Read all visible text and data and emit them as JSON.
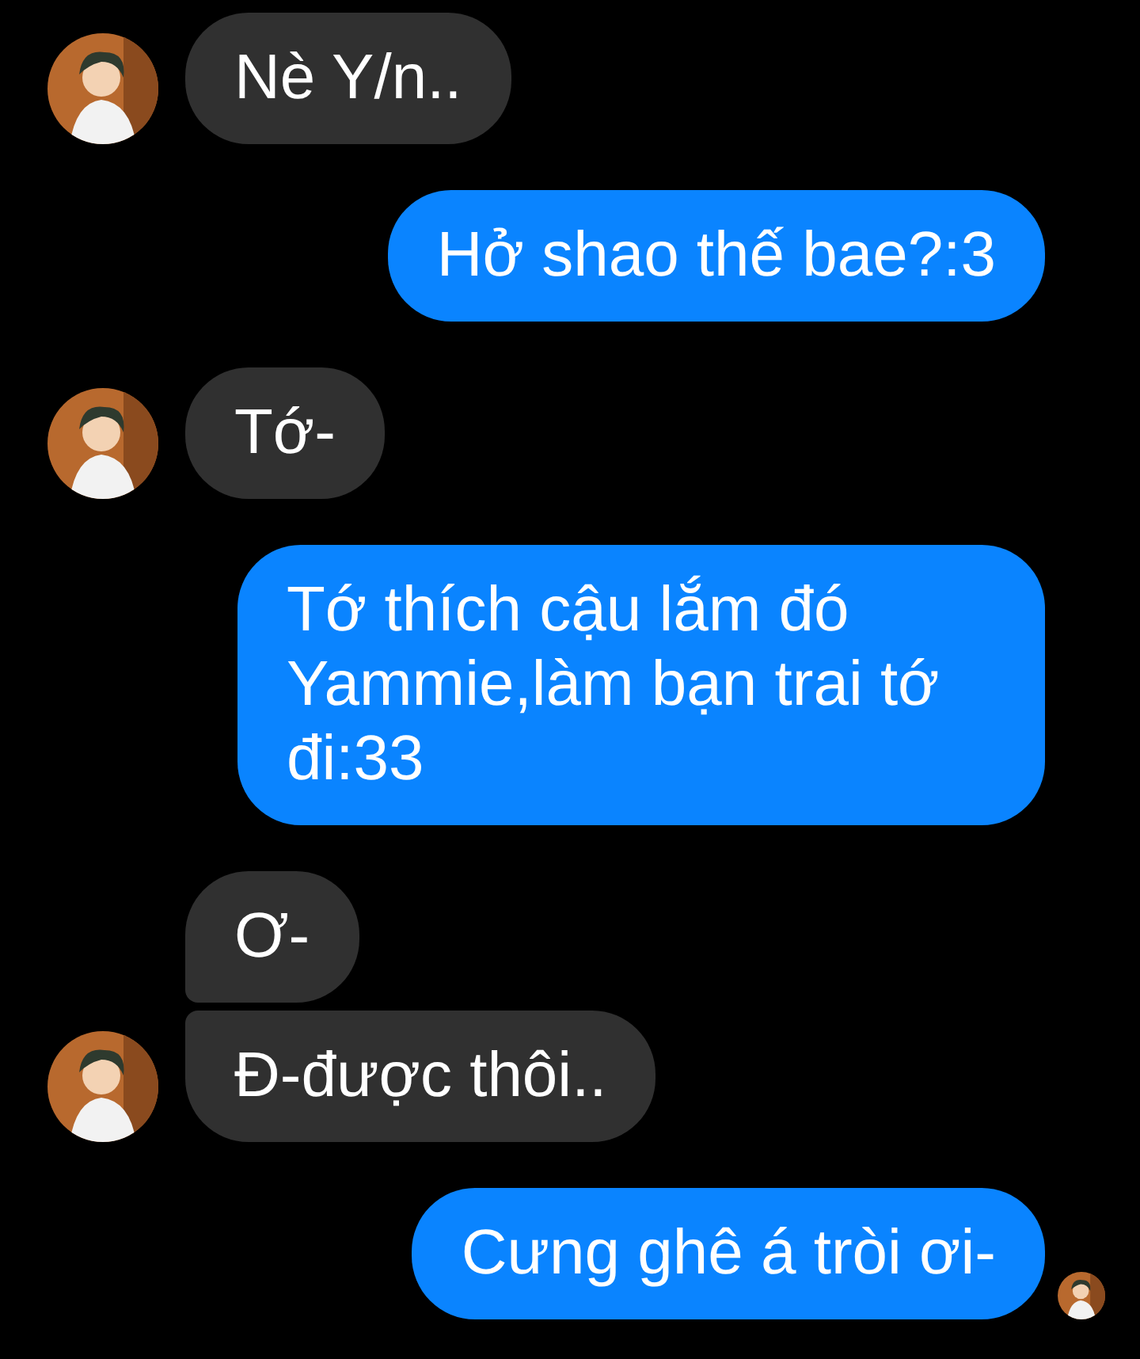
{
  "messages": [
    {
      "kind": "incoming",
      "show_avatar": true,
      "text": "Nè Y/n.."
    },
    {
      "kind": "outgoing",
      "seen": false,
      "text": "Hở shao thế bae?:3"
    },
    {
      "kind": "incoming",
      "show_avatar": true,
      "text": "Tớ-"
    },
    {
      "kind": "outgoing",
      "seen": false,
      "text": "Tớ thích cậu lắm đó Yammie,làm bạn trai tớ đi:33"
    },
    {
      "kind": "incoming",
      "show_avatar": false,
      "text": "Ơ-"
    },
    {
      "kind": "incoming",
      "show_avatar": true,
      "text": "Đ-được thôi.."
    },
    {
      "kind": "outgoing",
      "seen": true,
      "text": "Cưng ghê á tròi ơi-"
    }
  ]
}
